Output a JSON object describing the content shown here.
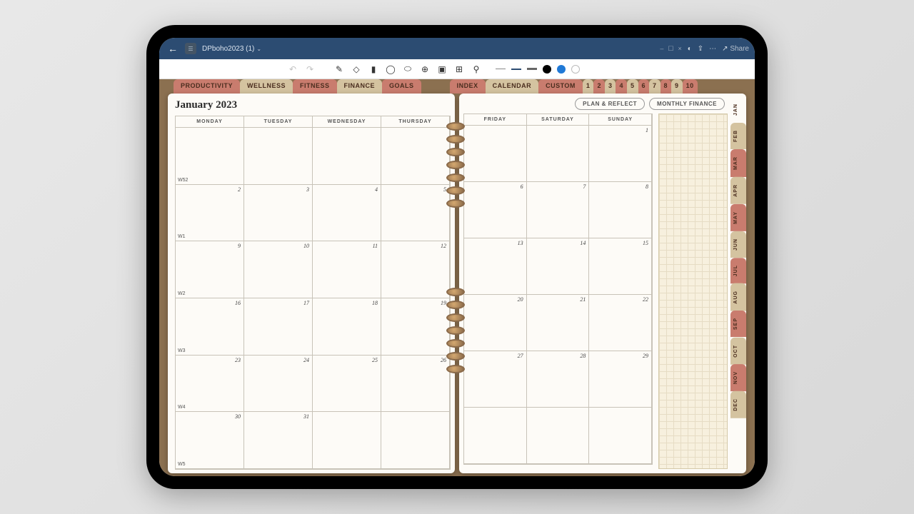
{
  "header": {
    "doc_name": "DPboho2023 (1)",
    "share": "Share"
  },
  "tabs": {
    "top": [
      "PRODUCTIVITY",
      "WELLNESS",
      "FITNESS",
      "FINANCE",
      "GOALS"
    ],
    "right": [
      "INDEX",
      "CALENDAR",
      "CUSTOM"
    ],
    "nums": [
      "1",
      "2",
      "3",
      "4",
      "5",
      "6",
      "7",
      "8",
      "9",
      "10"
    ]
  },
  "title": "January 2023",
  "buttons": {
    "plan": "PLAN  & REFLECT",
    "finance": "MONTHLY FINANCE"
  },
  "days_left": [
    "MONDAY",
    "TUESDAY",
    "WEDNESDAY",
    "THURSDAY"
  ],
  "days_right": [
    "FRIDAY",
    "SATURDAY",
    "SUNDAY"
  ],
  "weeks": [
    "W52",
    "W1",
    "W2",
    "W3",
    "W4",
    "W5"
  ],
  "rows_left": [
    [
      "",
      "",
      "",
      ""
    ],
    [
      "2",
      "3",
      "4",
      "5"
    ],
    [
      "9",
      "10",
      "11",
      "12"
    ],
    [
      "16",
      "17",
      "18",
      "19"
    ],
    [
      "23",
      "24",
      "25",
      "26"
    ],
    [
      "30",
      "31",
      "",
      ""
    ]
  ],
  "rows_right": [
    [
      "",
      "",
      "1"
    ],
    [
      "6",
      "7",
      "8"
    ],
    [
      "13",
      "14",
      "15"
    ],
    [
      "20",
      "21",
      "22"
    ],
    [
      "27",
      "28",
      "29"
    ],
    [
      "",
      "",
      ""
    ]
  ],
  "months": [
    "JAN",
    "FEB",
    "MAR",
    "APR",
    "MAY",
    "JUN",
    "JUL",
    "AUG",
    "SEP",
    "OCT",
    "NOV",
    "DEC"
  ]
}
